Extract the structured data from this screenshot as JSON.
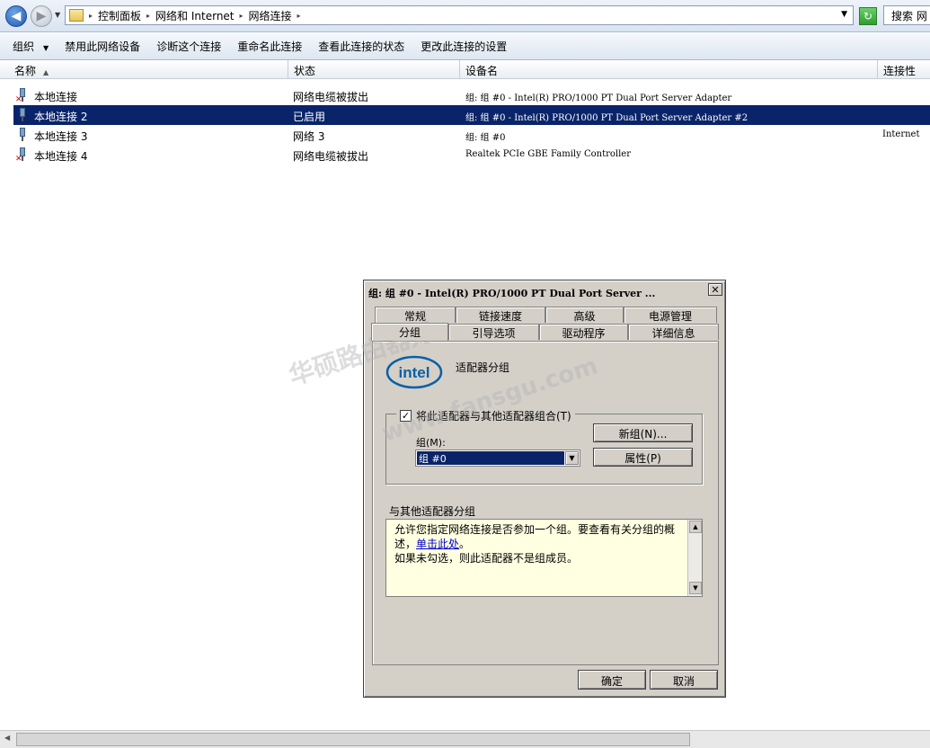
{
  "address": {
    "crumbs": [
      "控制面板",
      "网络和 Internet",
      "网络连接"
    ],
    "search_placeholder": "搜索 网"
  },
  "toolbar": {
    "items": [
      "组织",
      "禁用此网络设备",
      "诊断这个连接",
      "重命名此连接",
      "查看此连接的状态",
      "更改此连接的设置"
    ]
  },
  "columns": [
    "名称",
    "状态",
    "设备名",
    "连接性"
  ],
  "rows": [
    {
      "name": "本地连接",
      "status": "网络电缆被拔出",
      "device": "组: 组  #0 - Intel(R) PRO/1000 PT Dual Port Server Adapter",
      "connectivity": "",
      "disconnected": true,
      "selected": false
    },
    {
      "name": "本地连接 2",
      "status": "已启用",
      "device": "组: 组  #0 - Intel(R) PRO/1000 PT Dual Port Server Adapter #2",
      "connectivity": "",
      "disconnected": false,
      "selected": true
    },
    {
      "name": "本地连接 3",
      "status": "网络  3",
      "device": "组: 组  #0",
      "connectivity": "Internet",
      "disconnected": false,
      "selected": false
    },
    {
      "name": "本地连接 4",
      "status": "网络电缆被拔出",
      "device": "Realtek PCIe GBE Family Controller",
      "connectivity": "",
      "disconnected": true,
      "selected": false
    }
  ],
  "dialog": {
    "title": "组: 组  #0 - Intel(R) PRO/1000 PT Dual Port Server ...",
    "tabs_row1": [
      "常规",
      "链接速度",
      "高级",
      "电源管理"
    ],
    "tabs_row2": [
      "分组",
      "引导选项",
      "驱动程序",
      "详细信息"
    ],
    "logo_text": "intel",
    "heading": "适配器分组",
    "checkbox_label": "将此适配器与其他适配器组合(T)",
    "group_label": "组(M):",
    "group_value": "组  #0",
    "new_group_button": "新组(N)...",
    "properties_button": "属性(P)",
    "section_label": "与其他适配器分组",
    "info_line1": "允许您指定网络连接是否参加一个组。要查看有关分组的概述，",
    "info_link": "单击此处",
    "info_line1_end": "。",
    "info_line2": "如果未勾选，则此适配器不是组成员。",
    "ok_button": "确定",
    "cancel_button": "取消"
  },
  "watermark": {
    "line1": "华硕路由器好",
    "line2": "www.fansgu.com"
  }
}
